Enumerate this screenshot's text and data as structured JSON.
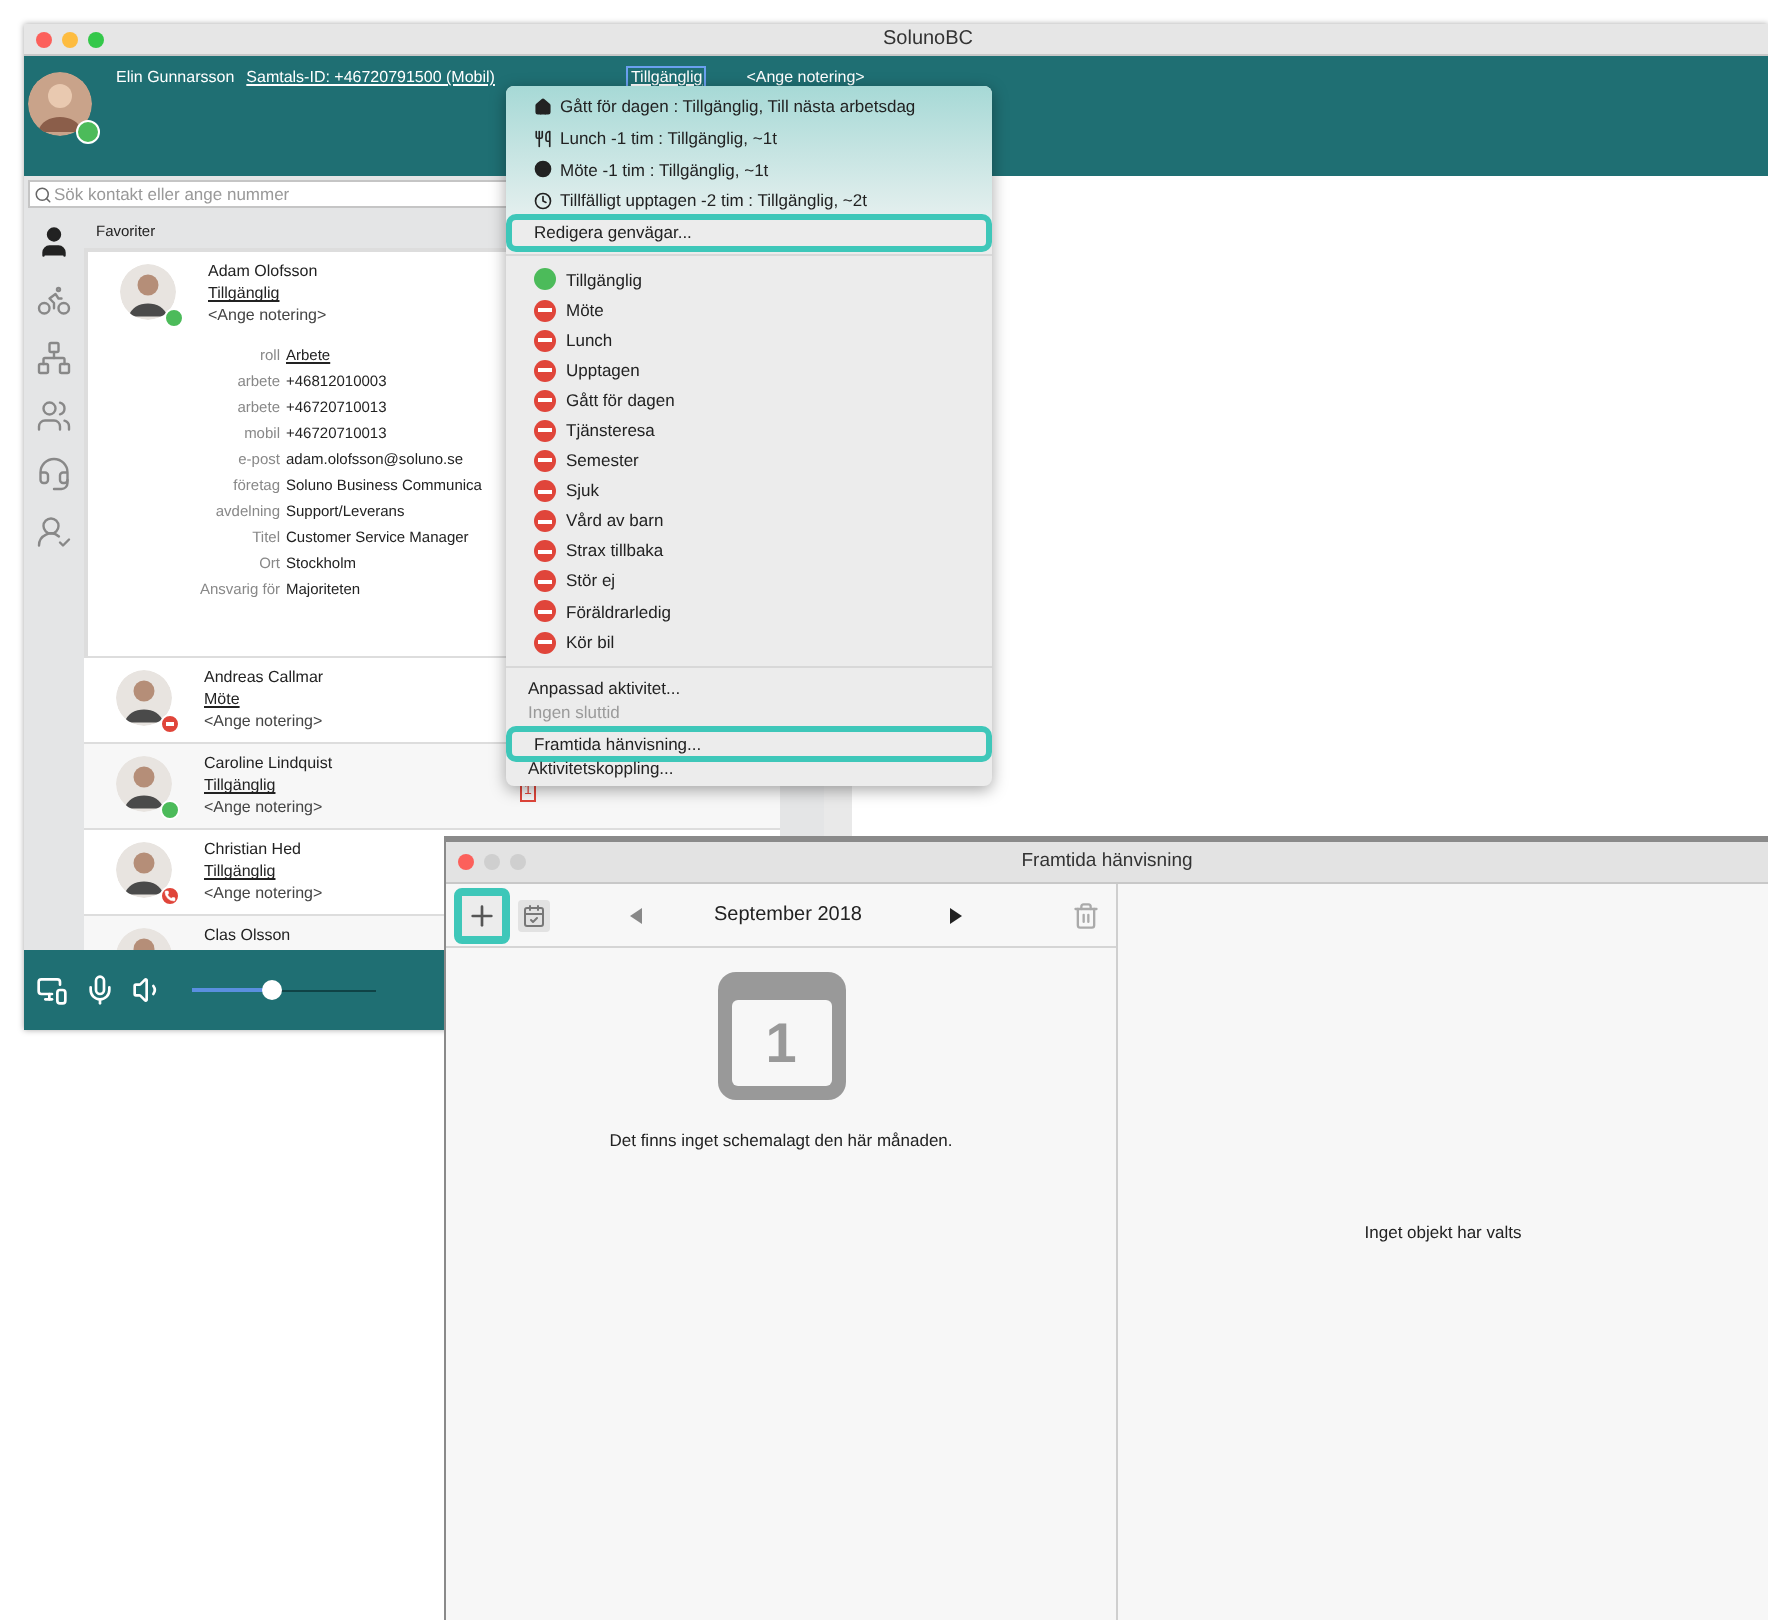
{
  "window": {
    "title": "SolunoBC"
  },
  "user": {
    "name": "Elin Gunnarsson",
    "call_id": "Samtals-ID: +46720791500 (Mobil)",
    "status": "Tillgänglig",
    "note": "<Ange notering>",
    "kind": "available"
  },
  "search": {
    "placeholder": "Sök kontakt eller ange nummer"
  },
  "nav": [
    {
      "kind": "contacts",
      "selected": true
    },
    {
      "kind": "activity",
      "selected": false
    },
    {
      "kind": "groups",
      "selected": false
    },
    {
      "kind": "queue",
      "selected": false
    },
    {
      "kind": "support",
      "selected": false
    },
    {
      "kind": "transfer",
      "selected": false
    }
  ],
  "favorites_label": "Favoriter",
  "contacts": [
    {
      "name": "Adam Olofsson",
      "status": "Tillgänglig",
      "note": "<Ange notering>",
      "kind": "available",
      "details": [
        {
          "label": "roll",
          "value": "Arbete",
          "kind": "link"
        },
        {
          "label": "arbete",
          "value": "+46812010003",
          "kind": "text"
        },
        {
          "label": "arbete",
          "value": "+46720710013",
          "kind": "text"
        },
        {
          "label": "mobil",
          "value": "+46720710013",
          "kind": "text"
        },
        {
          "label": "e-post",
          "value": "adam.olofsson@soluno.se",
          "kind": "text"
        },
        {
          "label": "företag",
          "value": "Soluno Business Communica",
          "kind": "text"
        },
        {
          "label": "avdelning",
          "value": "Support/Leverans",
          "kind": "text"
        },
        {
          "label": "Titel",
          "value": "Customer Service Manager",
          "kind": "text"
        },
        {
          "label": "Ort",
          "value": "Stockholm",
          "kind": "text"
        },
        {
          "label": "Ansvarig för",
          "value": "Majoriteten",
          "kind": "text"
        }
      ]
    },
    {
      "name": "Andreas Callmar",
      "status": "Möte",
      "note": "<Ange notering>",
      "kind": "busy"
    },
    {
      "name": "Caroline Lindquist",
      "status": "Tillgänglig",
      "note": "<Ange notering>",
      "kind": "available",
      "calendar_badge": "1"
    },
    {
      "name": "Christian Hed",
      "status": "Tillgänglig",
      "note": "<Ange notering>",
      "kind": "on_call"
    },
    {
      "name": "Clas Olsson",
      "kind": "none"
    }
  ],
  "volume": {
    "level": 0.43
  },
  "menu": {
    "shortcuts": [
      {
        "kind": "home",
        "label": "Gått för dagen : Tillgänglig, Till nästa arbetsdag"
      },
      {
        "kind": "lunch",
        "label": "Lunch -1 tim : Tillgänglig, ~1t"
      },
      {
        "kind": "meeting",
        "label": "Möte -1 tim : Tillgänglig, ~1t"
      },
      {
        "kind": "clock",
        "label": "Tillfälligt upptagen -2 tim : Tillgänglig, ~2t"
      }
    ],
    "edit_shortcuts": {
      "label": "Redigera genvägar...",
      "highlighted": true
    },
    "statuses": [
      {
        "label": "Tillgänglig",
        "kind": "available"
      },
      {
        "label": "Möte",
        "kind": "busy"
      },
      {
        "label": "Lunch",
        "kind": "busy"
      },
      {
        "label": "Upptagen",
        "kind": "busy"
      },
      {
        "label": "Gått för dagen",
        "kind": "busy"
      },
      {
        "label": "Tjänsteresa",
        "kind": "busy"
      },
      {
        "label": "Semester",
        "kind": "busy"
      },
      {
        "label": "Sjuk",
        "kind": "busy"
      },
      {
        "label": "Vård av barn",
        "kind": "busy"
      },
      {
        "label": "Strax tillbaka",
        "kind": "busy"
      },
      {
        "label": "Stör ej",
        "kind": "busy"
      },
      {
        "label": "Föräldrarledig",
        "kind": "busy"
      },
      {
        "label": "Kör bil",
        "kind": "busy"
      }
    ],
    "actions": [
      {
        "label": "Anpassad aktivitet...",
        "disabled": false,
        "highlighted": false
      },
      {
        "label": "Ingen sluttid",
        "disabled": true,
        "highlighted": false
      },
      {
        "label": "Framtida hänvisning...",
        "disabled": false,
        "highlighted": true
      },
      {
        "label": "Aktivitetskoppling...",
        "disabled": false,
        "highlighted": false
      }
    ]
  },
  "referral_window": {
    "title": "Framtida hänvisning",
    "add_highlighted": true,
    "month": "September 2018",
    "calendar_day": "1",
    "empty_message": "Det finns inget schemalagt den här månaden.",
    "detail_message": "Inget objekt har valts"
  }
}
